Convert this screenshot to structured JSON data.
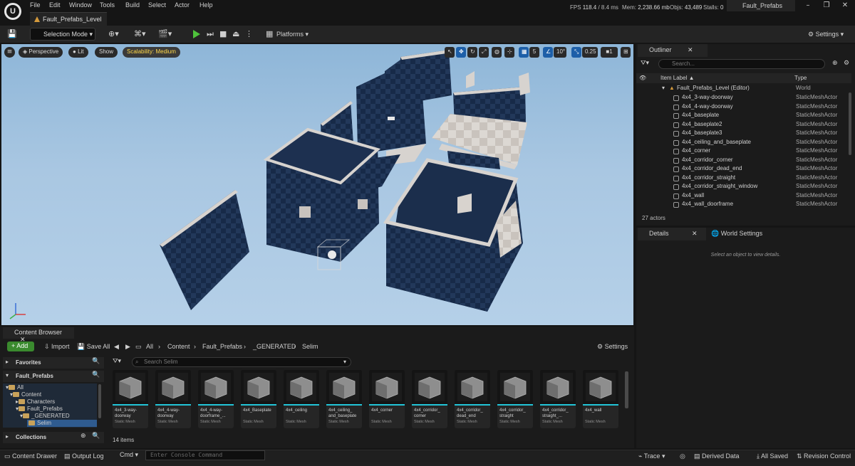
{
  "menu": [
    "File",
    "Edit",
    "Window",
    "Tools",
    "Build",
    "Select",
    "Actor",
    "Help"
  ],
  "level_tab": "Fault_Prefabs_Level",
  "stats": {
    "fps_label": "FPS",
    "fps": "118.4",
    "ms": "/ 8.4 ms",
    "mem_label": "Mem:",
    "mem": "2,238.66 mb",
    "objs_label": "Objs:",
    "objs": "43,489",
    "stalls_label": "Stalls:",
    "stalls": "0"
  },
  "project_name": "Fault_Prefabs",
  "toolbar": {
    "selection_mode": "Selection Mode",
    "platforms": "Platforms",
    "settings": "Settings"
  },
  "viewport": {
    "perspective": "Perspective",
    "lit": "Lit",
    "show": "Show",
    "scalability": "Scalability: Medium",
    "grid_snap": "5",
    "angle_snap": "10°",
    "scale_snap": "0.25",
    "camera_speed": "1"
  },
  "outliner": {
    "tab": "Outliner",
    "search_placeholder": "Search...",
    "col_label": "Item Label ▲",
    "col_type": "Type",
    "root": {
      "label": "Fault_Prefabs_Level (Editor)",
      "type": "World"
    },
    "rows": [
      {
        "label": "4x4_3-way-doorway",
        "type": "StaticMeshActor"
      },
      {
        "label": "4x4_4-way-doorway",
        "type": "StaticMeshActor"
      },
      {
        "label": "4x4_baseplate",
        "type": "StaticMeshActor"
      },
      {
        "label": "4x4_baseplate2",
        "type": "StaticMeshActor"
      },
      {
        "label": "4x4_baseplate3",
        "type": "StaticMeshActor"
      },
      {
        "label": "4x4_ceiling_and_baseplate",
        "type": "StaticMeshActor"
      },
      {
        "label": "4x4_corner",
        "type": "StaticMeshActor"
      },
      {
        "label": "4x4_corridor_corner",
        "type": "StaticMeshActor"
      },
      {
        "label": "4x4_corridor_dead_end",
        "type": "StaticMeshActor"
      },
      {
        "label": "4x4_corridor_straight",
        "type": "StaticMeshActor"
      },
      {
        "label": "4x4_corridor_straight_window",
        "type": "StaticMeshActor"
      },
      {
        "label": "4x4_wall",
        "type": "StaticMeshActor"
      },
      {
        "label": "4x4_wall_doorframe",
        "type": "StaticMeshActor"
      }
    ],
    "actor_count": "27 actors"
  },
  "details": {
    "tab": "Details",
    "world_settings_tab": "World Settings",
    "empty_msg": "Select an object to view details."
  },
  "content_browser": {
    "tab": "Content Browser",
    "add": "Add",
    "import": "Import",
    "save_all": "Save All",
    "settings": "Settings",
    "path": [
      "All",
      "Content",
      "Fault_Prefabs",
      "_GENERATED",
      "Selim"
    ],
    "search_placeholder": "Search Selim",
    "favorites": "Favorites",
    "project": "Fault_Prefabs",
    "tree": [
      "All",
      "Content",
      "Characters",
      "Fault_Prefabs",
      "_GENERATED",
      "Selim"
    ],
    "collections": "Collections",
    "assets": [
      {
        "name": "4x4_3-way-\ndoorway",
        "type": "Static Mesh"
      },
      {
        "name": "4x4_4-way-\ndoorway",
        "type": "Static Mesh"
      },
      {
        "name": "4x4_4-way-\ndoorframe_...",
        "type": "Static Mesh"
      },
      {
        "name": "4x4_Baseplate",
        "type": "Static Mesh"
      },
      {
        "name": "4x4_ceiling",
        "type": "Static Mesh"
      },
      {
        "name": "4x4_ceiling_\nand_baseplate",
        "type": "Static Mesh"
      },
      {
        "name": "4x4_corner",
        "type": "Static Mesh"
      },
      {
        "name": "4x4_corridor_\ncorner",
        "type": "Static Mesh"
      },
      {
        "name": "4x4_corridor_\ndead_end",
        "type": "Static Mesh"
      },
      {
        "name": "4x4_corridor_\nstraight",
        "type": "Static Mesh"
      },
      {
        "name": "4x4_corridor_\nstraight_...",
        "type": "Static Mesh"
      },
      {
        "name": "4x4_wall",
        "type": "Static Mesh"
      }
    ],
    "item_count": "14 items"
  },
  "status_bar": {
    "content_drawer": "Content Drawer",
    "output_log": "Output Log",
    "cmd": "Cmd",
    "console_placeholder": "Enter Console Command",
    "trace": "Trace",
    "derived_data": "Derived Data",
    "all_saved": "All Saved",
    "revision_control": "Revision Control"
  },
  "colors": {
    "accent_play": "#4ec23b",
    "add_button": "#3a8a2e",
    "asset_bar": "#22c5d8",
    "folder": "#c9a25a",
    "scalability": "#ffd84a"
  }
}
